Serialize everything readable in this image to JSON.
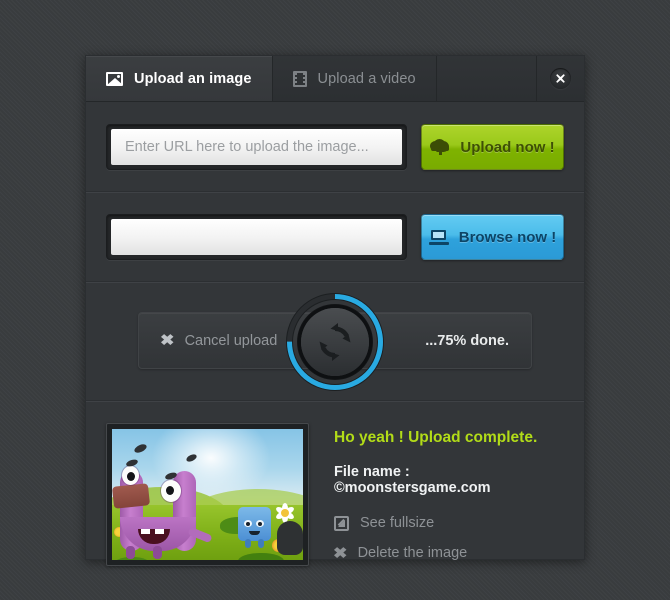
{
  "window": {
    "close_label": "✖"
  },
  "tabs": [
    {
      "id": "image",
      "label": "Upload an image",
      "icon": "image-icon",
      "active": true
    },
    {
      "id": "video",
      "label": "Upload a video",
      "icon": "film-icon",
      "active": false
    }
  ],
  "url_section": {
    "input_placeholder": "Enter URL here to upload the image...",
    "input_value": "",
    "button_label": "Upload now !",
    "button_icon": "cloud-upload-icon",
    "button_color": "#9ac91a"
  },
  "browse_section": {
    "input_placeholder": "",
    "input_value": "",
    "button_label": "Browse now !",
    "button_icon": "laptop-icon",
    "button_color": "#3aaee1"
  },
  "progress_section": {
    "cancel_label": "Cancel upload",
    "cancel_icon": "close-x-icon",
    "status_text": "...75% done.",
    "percent": 75,
    "ring_color": "#29aae2",
    "ring_track_color": "#232629",
    "spinner_icon": "refresh-sync-icon"
  },
  "result_section": {
    "headline": "Ho yeah ! Upload complete.",
    "headline_color": "#b2dc18",
    "filename_label": "File name : ©moonstersgame.com",
    "actions": [
      {
        "id": "fullsize",
        "label": "See fullsize",
        "icon": "fullsize-arrow-icon"
      },
      {
        "id": "delete",
        "label": "Delete the image",
        "icon": "close-x-icon"
      }
    ],
    "thumbnail_alt": "Cartoon game screenshot with purple monster on grass"
  }
}
